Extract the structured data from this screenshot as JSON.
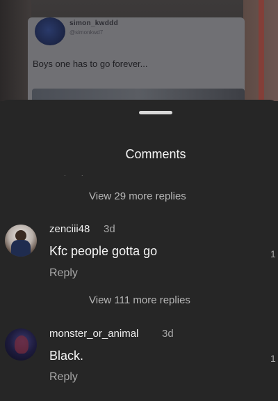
{
  "background_post": {
    "author_name": "simon_kwddd",
    "author_handle": "@simonkwd7",
    "text": "Boys one has to go forever..."
  },
  "sheet": {
    "title": "Comments",
    "top_view_replies": "View 29 more replies"
  },
  "comments": [
    {
      "username": "zenciii48",
      "time": "3d",
      "text": "Kfc people gotta go",
      "reply_label": "Reply",
      "like_count": "1",
      "view_replies": "View 111 more replies"
    },
    {
      "username": "monster_or_animal",
      "time": "3d",
      "text": "Black.",
      "reply_label": "Reply",
      "like_count": "1"
    }
  ]
}
